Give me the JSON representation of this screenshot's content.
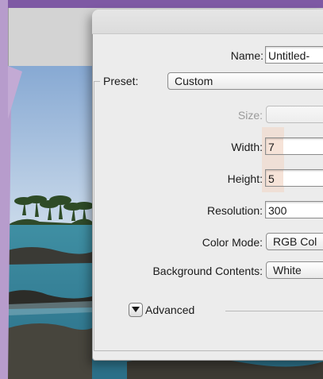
{
  "dialog": {
    "name_label": "Name:",
    "name_value": "Untitled-",
    "preset_label": "Preset:",
    "preset_value": "Custom",
    "size_label": "Size:",
    "size_value": "",
    "width_label": "Width:",
    "width_value": "7",
    "height_label": "Height:",
    "height_value": "5",
    "resolution_label": "Resolution:",
    "resolution_value": "300",
    "color_mode_label": "Color Mode:",
    "color_mode_value": "RGB Col",
    "background_label": "Background Contents:",
    "background_value": "White",
    "advanced_label": "Advanced"
  },
  "icons": {
    "advanced_toggle": "triangle-down-icon"
  },
  "colors": {
    "window_top": "#7e59a4",
    "side_panel": "#b79ccc",
    "dialog_bg": "#ececec",
    "field_highlight": "#f3d6c4"
  }
}
